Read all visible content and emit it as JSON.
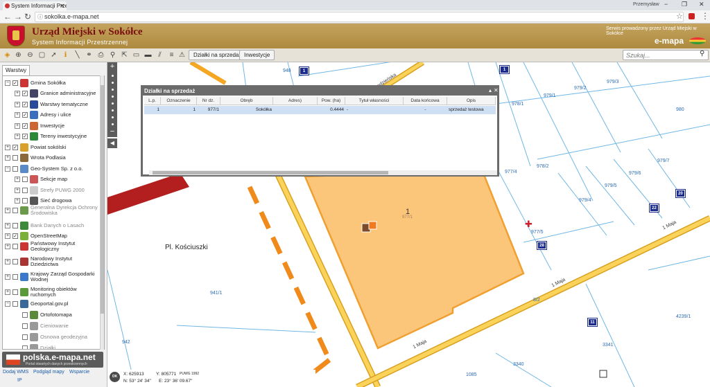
{
  "browser": {
    "tab_title": "System Informacji Przes",
    "user": "Przemysław",
    "url": "sokolka.e-mapa.net"
  },
  "header": {
    "title": "Urząd Miejski w Sokółce",
    "subtitle": "System Informacji Przestrzennej",
    "service_note": "Serwis prowadzony przez Urząd Miejski w Sokółce",
    "brand": "e-mapa"
  },
  "toolbar": {
    "btn_sale": "Działki na sprzedaż",
    "btn_invest": "Inwestycje",
    "search_placeholder": "Szukaj..."
  },
  "panel": {
    "tab": "Warstwy",
    "layers": [
      {
        "label": "Gmina Sokółka",
        "exp": "−",
        "checked": true,
        "indent": 0,
        "color": "#c33"
      },
      {
        "label": "Granice administracyjne",
        "exp": "+",
        "checked": true,
        "indent": 1,
        "color": "#446"
      },
      {
        "label": "Warstwy tematyczne",
        "exp": "+",
        "checked": true,
        "indent": 1,
        "color": "#2a4a9a"
      },
      {
        "label": "Adresy i ulice",
        "exp": "+",
        "checked": true,
        "indent": 1,
        "color": "#3a6fbf"
      },
      {
        "label": "Inwestycje",
        "exp": "+",
        "checked": true,
        "indent": 1,
        "color": "#c63"
      },
      {
        "label": "Tereny inwestycyjne",
        "exp": "+",
        "checked": true,
        "indent": 1,
        "color": "#2a8a3a"
      },
      {
        "label": "Powiat sokólski",
        "exp": "+",
        "checked": true,
        "indent": 0,
        "color": "#d9a12a"
      },
      {
        "label": "Wrota Podlasia",
        "exp": "+",
        "checked": false,
        "indent": 0,
        "color": "#8a6a3a"
      },
      {
        "label": "Geo-System Sp. z o.o.",
        "exp": "−",
        "checked": false,
        "indent": 0,
        "color": "#5a8ac8"
      },
      {
        "label": "Sekcje map",
        "exp": "+",
        "checked": false,
        "indent": 1,
        "color": "#c55"
      },
      {
        "label": "Strefy PUWG 2000",
        "exp": "+",
        "checked": false,
        "indent": 1,
        "color": "#ccc",
        "dim": true
      },
      {
        "label": "Sieć drogowa",
        "exp": "+",
        "checked": false,
        "indent": 1,
        "color": "#555"
      },
      {
        "label": "Generalna Dyrekcja Ochrony Środowiska",
        "exp": "+",
        "checked": false,
        "indent": 0,
        "color": "#6a9a4a",
        "dim": true
      },
      {
        "label": "Bank Danych o Lasach",
        "exp": "+",
        "checked": false,
        "indent": 0,
        "color": "#3a8a3a",
        "dim": true
      },
      {
        "label": "OpenStreetMap",
        "exp": "+",
        "checked": true,
        "indent": 0,
        "color": "#7ab03a"
      },
      {
        "label": "Państwowy Instytut Geologiczny",
        "exp": "+",
        "checked": false,
        "indent": 0,
        "color": "#c33"
      },
      {
        "label": "Narodowy Instytut Dziedzictwa",
        "exp": "+",
        "checked": false,
        "indent": 0,
        "color": "#a33"
      },
      {
        "label": "Krajowy Zarząd Gospodarki Wodnej",
        "exp": "+",
        "checked": false,
        "indent": 0,
        "color": "#3a7ac8"
      },
      {
        "label": "Monitoring obiektów ruchomych",
        "exp": "+",
        "checked": false,
        "indent": 0,
        "color": "#5a9a3a"
      },
      {
        "label": "Geoportal.gov.pl",
        "exp": "−",
        "checked": false,
        "indent": 0,
        "color": "#3a6a9a"
      },
      {
        "label": "Ortofotomapa",
        "exp": "",
        "checked": false,
        "indent": 1,
        "color": "#5a8a3a"
      },
      {
        "label": "Cieniowanie",
        "exp": "",
        "checked": false,
        "indent": 1,
        "color": "#999",
        "dim": true
      },
      {
        "label": "Osnowa geodezyjna",
        "exp": "",
        "checked": false,
        "indent": 1,
        "color": "#999",
        "dim": true
      },
      {
        "label": "Działki",
        "exp": "",
        "checked": false,
        "indent": 1,
        "color": "#999",
        "dim": true
      }
    ],
    "logo_text": "polska.e-mapa.net",
    "logo_sub": "Portal otwartych danych przestrzennych",
    "links": [
      "Dodaj WMS",
      "Podgląd mapy",
      "Wsparcie",
      "IP"
    ]
  },
  "dialog": {
    "title": "Działki na sprzedaż",
    "columns": [
      "L.p.",
      "Oznaczenie",
      "Nr dz.",
      "Obręb",
      "Adres)",
      "Pow. (ha)",
      "Tytuł własności",
      "Data końcowa",
      "Opis"
    ],
    "rows": [
      [
        "1",
        "1",
        "977/1",
        "Sokółka",
        "",
        "0.4444",
        "-",
        "-",
        "sprzedaż testowa"
      ]
    ]
  },
  "map": {
    "place_name": "Pl. Kościuszki",
    "parcels": [
      "948",
      "979/1",
      "979/2",
      "979/3",
      "978/1",
      "980",
      "977/4",
      "978/2",
      "979/7",
      "979/6",
      "979/5",
      "979/4",
      "977/5",
      "941/1",
      "942",
      "3341",
      "4239/1",
      "3340",
      "1085",
      "1",
      "977/1",
      "8/2"
    ],
    "badges": [
      "1",
      "1",
      "20",
      "22",
      "28",
      "11"
    ],
    "streets": [
      "Trasa rowerowa",
      "1 Maja",
      "1 Maja",
      "1 Maja",
      "Grodzieńska"
    ],
    "coords": {
      "x": "X: 625913",
      "y": "Y: 805771",
      "system": "PUWG 1992",
      "n": "N: 53° 24' 34\"",
      "e": "E: 23° 36' 09.67\""
    }
  },
  "colors": {
    "header": "#b8954a",
    "parcel_fill": "#fbc57a",
    "parcel_border": "#f0a030",
    "road": "#f5a623",
    "dialog_frame": "#6b6b6b",
    "selected_row": "#cfe0f5"
  }
}
